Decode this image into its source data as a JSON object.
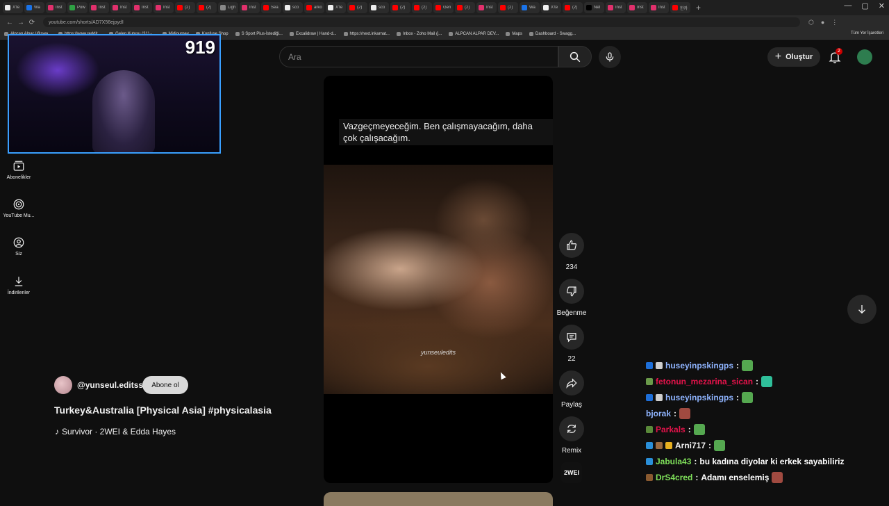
{
  "browser": {
    "tabs": [
      {
        "label": "X'te",
        "color": "#eeeeee"
      },
      {
        "label": "Wa",
        "color": "#1a73e8"
      },
      {
        "label": "Inst",
        "color": "#e1306c"
      },
      {
        "label": "Pow",
        "color": "#2ea043"
      },
      {
        "label": "Inst",
        "color": "#e1306c"
      },
      {
        "label": "Inst",
        "color": "#e1306c"
      },
      {
        "label": "Inst",
        "color": "#e1306c"
      },
      {
        "label": "Inst",
        "color": "#e1306c"
      },
      {
        "label": "(2)",
        "color": "#ff0000"
      },
      {
        "label": "(2)",
        "color": "#ff0000"
      },
      {
        "label": "Ligh",
        "color": "#888888"
      },
      {
        "label": "Inst",
        "color": "#e1306c"
      },
      {
        "label": "Sea",
        "color": "#ff0000"
      },
      {
        "label": "sco",
        "color": "#eeeeee"
      },
      {
        "label": "arko",
        "color": "#ff0000"
      },
      {
        "label": "X'te",
        "color": "#eeeeee"
      },
      {
        "label": "(2)",
        "color": "#ff0000"
      },
      {
        "label": "sco",
        "color": "#eeeeee"
      },
      {
        "label": "(2)",
        "color": "#ff0000"
      },
      {
        "label": "(2)",
        "color": "#ff0000"
      },
      {
        "label": "Gen",
        "color": "#ff0000"
      },
      {
        "label": "(2)",
        "color": "#ff0000"
      },
      {
        "label": "Inst",
        "color": "#e1306c"
      },
      {
        "label": "(2)",
        "color": "#ff0000"
      },
      {
        "label": "Wa",
        "color": "#1a73e8"
      },
      {
        "label": "X'te",
        "color": "#eeeeee"
      },
      {
        "label": "(2)",
        "color": "#ff0000"
      },
      {
        "label": "Net",
        "color": "#000000"
      },
      {
        "label": "Inst",
        "color": "#e1306c"
      },
      {
        "label": "Inst",
        "color": "#e1306c"
      },
      {
        "label": "Inst",
        "color": "#e1306c"
      },
      {
        "label": "한카",
        "color": "#ff0000"
      }
    ],
    "url": "youtube.com/shorts/AD7X56ejpydI",
    "bookmarks": [
      "Alpcan Alpar (@swa...",
      "https://www.reddit....",
      "Gelen Kutusu (31) -...",
      "Midjourney",
      "Konfuse Shop",
      "S Sport Plus-İstediği...",
      "Excalidraw | Hand-d...",
      "https://next.inkarnat...",
      "Inbox - Zoho Mail (j...",
      "ALPCAN ALPAR DEV...",
      "Maps",
      "Dashboard - Swagg..."
    ],
    "bookmarks_all": "Tüm Yer İşaretleri"
  },
  "webcam": {
    "counter": "919"
  },
  "nav": {
    "items": [
      {
        "label": "Abonelikler",
        "icon": "subscriptions-icon"
      },
      {
        "label": "YouTube Mu...",
        "icon": "youtube-music-icon"
      },
      {
        "label": "Siz",
        "icon": "you-icon"
      },
      {
        "label": "İndirilenler",
        "icon": "downloads-icon"
      }
    ]
  },
  "header": {
    "search_placeholder": "Ara",
    "create_label": "Oluştur",
    "notif_count": "2"
  },
  "video": {
    "subtitle": "Vazgeçmeyeceğim.  Ben çalışmayacağım, daha çok çalışacağım.",
    "watermark": "yunseuledits"
  },
  "actions": {
    "like_count": "234",
    "dislike_label": "Beğenme",
    "comment_count": "22",
    "share_label": "Paylaş",
    "remix_label": "Remix",
    "sound_label": "2WEI"
  },
  "channel": {
    "name": "@yunseul.editss",
    "subscribe_label": "Abone ol",
    "title": "Turkey&Australia [Physical Asia] #physicalasia",
    "music": "Survivor · 2WEI & Edda Hayes"
  },
  "chat": {
    "messages": [
      {
        "user": "huseyinpskingps",
        "color": "#8fb4ff",
        "text": "",
        "badges": [
          "#1e6fd9",
          "#cfcfcf"
        ],
        "emote": "#55a850"
      },
      {
        "user": "fetonun_mezarina_sican",
        "color": "#e5134b",
        "text": "",
        "badges": [
          "#6a9a4a"
        ],
        "emote": "#2fbf9a"
      },
      {
        "user": "huseyinpskingps",
        "color": "#8fb4ff",
        "text": "",
        "badges": [
          "#1e6fd9",
          "#cfcfcf"
        ],
        "emote": "#55a850"
      },
      {
        "user": "bjorak",
        "color": "#8fb4ff",
        "text": "",
        "badges": [],
        "emote": "#a04a40"
      },
      {
        "user": "Parkals",
        "color": "#e5134b",
        "text": "",
        "badges": [
          "#5a8a3a"
        ],
        "emote": "#55a850"
      },
      {
        "user": "Arni717",
        "color": "#f1f1f1",
        "text": "",
        "badges": [
          "#2a8fd9",
          "#9a6a40",
          "#e8b020"
        ],
        "emote": "#55a850"
      },
      {
        "user": "Jabula43",
        "color": "#7fe05a",
        "text": "bu kadına diyolar ki erkek sayabiliriz",
        "badges": [
          "#2a8fd9"
        ],
        "emote": ""
      },
      {
        "user": "DrS4cred",
        "color": "#7fe05a",
        "text": "Adamı enselemiş",
        "badges": [
          "#8a5a30"
        ],
        "emote": "#a04a40"
      }
    ]
  }
}
